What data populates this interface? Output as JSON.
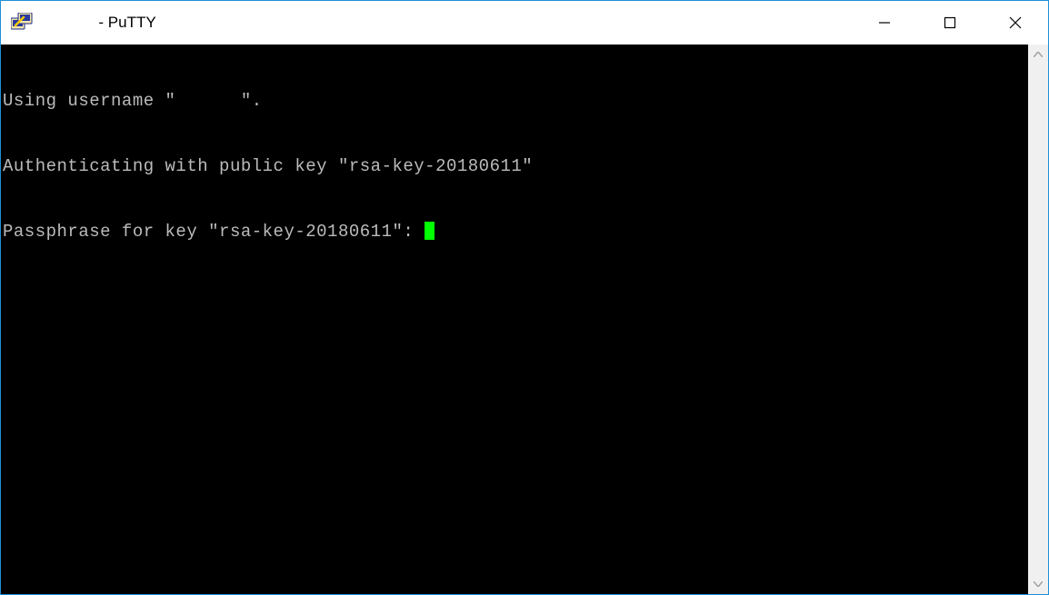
{
  "titlebar": {
    "title_prefix": "             ",
    "title_app": "- PuTTY"
  },
  "terminal": {
    "lines": [
      "Using username \"      \".",
      "Authenticating with public key \"rsa-key-20180611\"",
      "Passphrase for key \"rsa-key-20180611\": "
    ],
    "cursor_color": "#00ff00",
    "background": "#000000",
    "foreground": "#bbbbbb"
  }
}
